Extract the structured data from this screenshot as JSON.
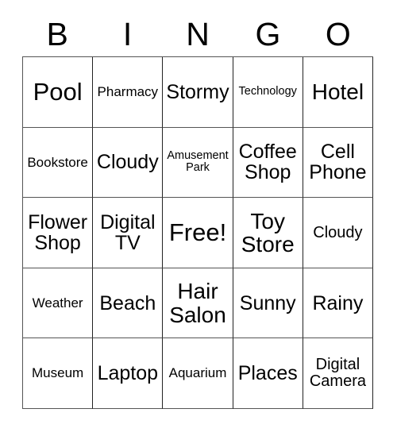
{
  "header": {
    "letters": [
      "B",
      "I",
      "N",
      "G",
      "O"
    ]
  },
  "grid": {
    "rows": [
      [
        {
          "label": "Pool",
          "size": "fs-xl"
        },
        {
          "label": "Pharmacy",
          "size": "fs-xs"
        },
        {
          "label": "Stormy",
          "size": "fs-md"
        },
        {
          "label": "Technology",
          "size": "fs-xxs"
        },
        {
          "label": "Hotel",
          "size": "fs-lg"
        }
      ],
      [
        {
          "label": "Bookstore",
          "size": "fs-xs"
        },
        {
          "label": "Cloudy",
          "size": "fs-md"
        },
        {
          "label": "Amusement Park",
          "size": "fs-xxs"
        },
        {
          "label": "Coffee Shop",
          "size": "fs-md"
        },
        {
          "label": "Cell Phone",
          "size": "fs-md"
        }
      ],
      [
        {
          "label": "Flower Shop",
          "size": "fs-md"
        },
        {
          "label": "Digital TV",
          "size": "fs-md"
        },
        {
          "label": "Free!",
          "size": "fs-xl"
        },
        {
          "label": "Toy Store",
          "size": "fs-lg"
        },
        {
          "label": "Cloudy",
          "size": "fs-sm"
        }
      ],
      [
        {
          "label": "Weather",
          "size": "fs-xs"
        },
        {
          "label": "Beach",
          "size": "fs-md"
        },
        {
          "label": "Hair Salon",
          "size": "fs-lg"
        },
        {
          "label": "Sunny",
          "size": "fs-md"
        },
        {
          "label": "Rainy",
          "size": "fs-md"
        }
      ],
      [
        {
          "label": "Museum",
          "size": "fs-xs"
        },
        {
          "label": "Laptop",
          "size": "fs-md"
        },
        {
          "label": "Aquarium",
          "size": "fs-xs"
        },
        {
          "label": "Places",
          "size": "fs-md"
        },
        {
          "label": "Digital Camera",
          "size": "fs-sm"
        }
      ]
    ]
  },
  "colors": {
    "background": "#ffffff",
    "text": "#000000",
    "grid_line": "#555555"
  }
}
